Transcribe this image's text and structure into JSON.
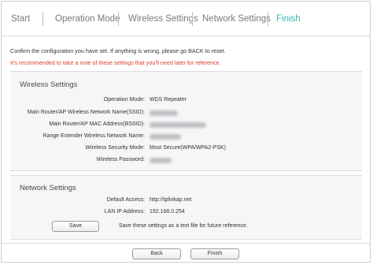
{
  "tabs": [
    "Start",
    "Operation Mode",
    "Wireless Settings",
    "Network Settings",
    "Finish"
  ],
  "active_tab_index": 4,
  "confirm_text": "Confirm the configuration you have set. If anything is wrong, please go BACK to reset.",
  "warning_text": "It's recommended to take a note of these settings that you'll need later for reference.",
  "wireless": {
    "title": "Wireless Settings",
    "rows": [
      {
        "label": "Operation Mode:",
        "value": "WDS Repeater"
      },
      {
        "label": "Main Router/AP Wireless Network Name(SSID):",
        "value": ""
      },
      {
        "label": "Main Router/AP MAC Address(BSSID):",
        "value": ""
      },
      {
        "label": "Range Extender Wireless Network Name:",
        "value": ""
      },
      {
        "label": "Wireless Security Mode:",
        "value": "Most Secure(WPA/WPA2-PSK)"
      },
      {
        "label": "Wireless Password:",
        "value": ""
      }
    ]
  },
  "network": {
    "title": "Network Settings",
    "rows": [
      {
        "label": "Default Access:",
        "value": "http://tplinkap.net"
      },
      {
        "label": "LAN IP Address:",
        "value": "192.168.0.254"
      }
    ],
    "save_label": "Save",
    "save_hint": "Save these settings as a text file for future reference."
  },
  "footer": {
    "back_label": "Back",
    "finish_label": "Finish"
  },
  "colors": {
    "accent": "#3fb3b0",
    "warning": "#e23b2f",
    "panel_bg": "#f6f6f6"
  }
}
